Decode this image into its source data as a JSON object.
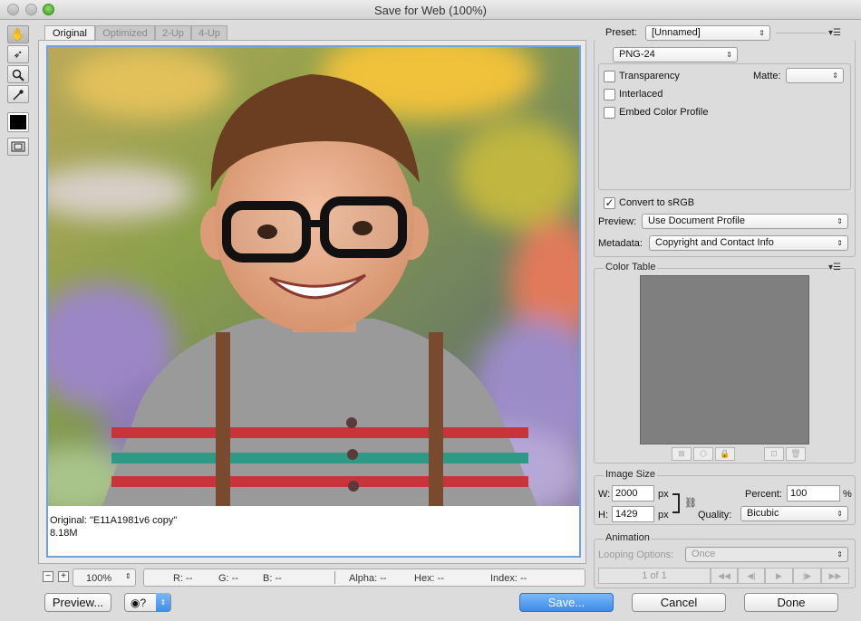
{
  "window": {
    "title": "Save for Web (100%)"
  },
  "tabs": [
    "Original",
    "Optimized",
    "2-Up",
    "4-Up"
  ],
  "image_info": {
    "name_line": "Original: \"E11A1981v6 copy\"",
    "size_line": "8.18M"
  },
  "status": {
    "zoom": "100%",
    "r": "R: --",
    "g": "G: --",
    "b": "B: --",
    "alpha": "Alpha: --",
    "hex": "Hex: --",
    "index": "Index: --"
  },
  "bottom_buttons": {
    "preview": "Preview...",
    "save": "Save...",
    "cancel": "Cancel",
    "done": "Done"
  },
  "settings": {
    "preset_label": "Preset:",
    "preset_value": "[Unnamed]",
    "format_value": "PNG-24",
    "transparency_label": "Transparency",
    "matte_label": "Matte:",
    "interlaced_label": "Interlaced",
    "embed_label": "Embed Color Profile",
    "convert_label": "Convert to sRGB",
    "preview_label": "Preview:",
    "preview_value": "Use Document Profile",
    "metadata_label": "Metadata:",
    "metadata_value": "Copyright and Contact Info"
  },
  "color_table": {
    "label": "Color Table"
  },
  "image_size": {
    "label": "Image Size",
    "w_label": "W:",
    "w_value": "2000",
    "h_label": "H:",
    "h_value": "1429",
    "unit": "px",
    "percent_label": "Percent:",
    "percent_value": "100",
    "percent_unit": "%",
    "quality_label": "Quality:",
    "quality_value": "Bicubic"
  },
  "animation": {
    "label": "Animation",
    "looping_label": "Looping Options:",
    "looping_value": "Once",
    "frame_counter": "1 of 1"
  },
  "colors": {
    "accent": "#3d8bea",
    "selection_border": "#6fa3dc"
  }
}
